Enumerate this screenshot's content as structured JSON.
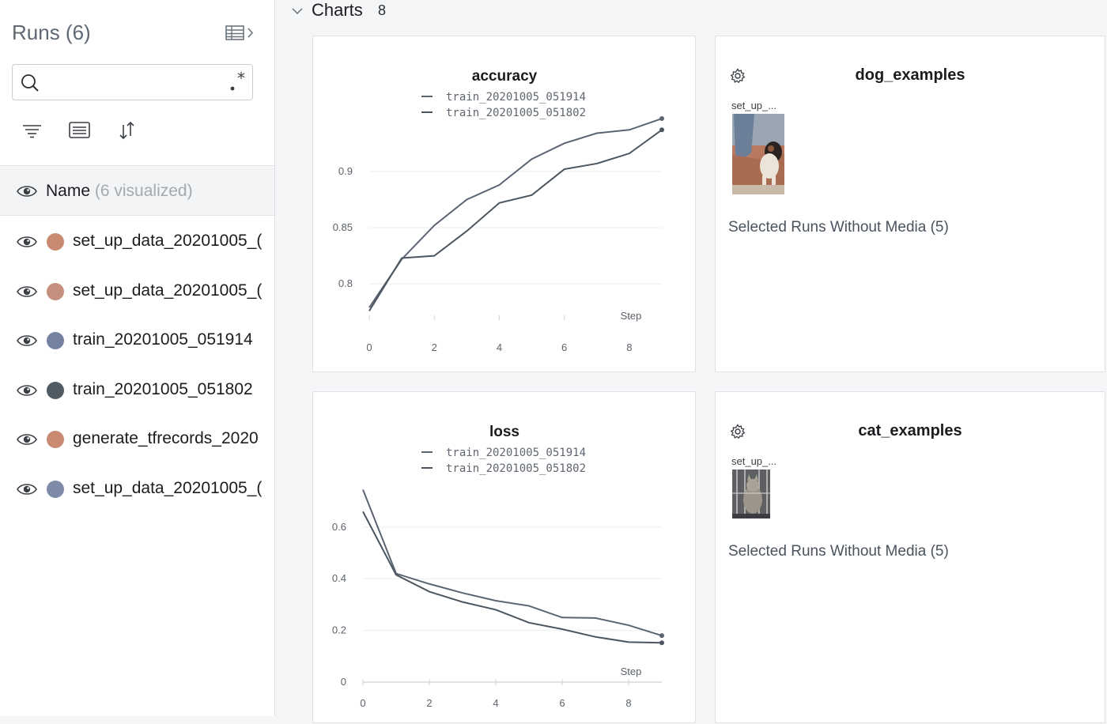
{
  "sidebar": {
    "title": "Runs (6)",
    "search": {
      "value": "",
      "placeholder": ""
    },
    "regex_label": ".*",
    "name_header": {
      "label": "Name",
      "count": "(6 visualized)"
    },
    "runs": [
      {
        "name": "set_up_data_20201005_(",
        "color": "#c98a72"
      },
      {
        "name": "set_up_data_20201005_(",
        "color": "#c4907d"
      },
      {
        "name": "train_20201005_051914",
        "color": "#7481a0"
      },
      {
        "name": "train_20201005_051802",
        "color": "#4f5a62"
      },
      {
        "name": "generate_tfrecords_2020",
        "color": "#c98a72"
      },
      {
        "name": "set_up_data_20201005_(",
        "color": "#7f8aa8"
      }
    ]
  },
  "section": {
    "title": "Charts",
    "count": "8"
  },
  "charts": [
    {
      "title": "accuracy",
      "legend": [
        "train_20201005_051914",
        "train_20201005_051802"
      ],
      "xlabel": "Step",
      "chart_data": {
        "type": "line",
        "title": "accuracy",
        "xlabel": "Step",
        "ylabel": "",
        "x": [
          0,
          1,
          2,
          3,
          4,
          5,
          6,
          7,
          8,
          9
        ],
        "xlim": [
          0,
          9
        ],
        "ylim": [
          0.765,
          0.94
        ],
        "xticks": [
          0,
          2,
          4,
          6,
          8
        ],
        "yticks": [
          0.8,
          0.85,
          0.9
        ],
        "series": [
          {
            "name": "train_20201005_051914",
            "color": "#5a6472",
            "values": [
              0.779,
              0.822,
              0.852,
              0.875,
              0.888,
              0.911,
              0.925,
              0.934,
              0.937,
              0.947
            ]
          },
          {
            "name": "train_20201005_051802",
            "color": "#4b5660",
            "values": [
              0.776,
              0.823,
              0.825,
              0.847,
              0.872,
              0.879,
              0.902,
              0.907,
              0.916,
              0.937
            ]
          }
        ]
      }
    },
    {
      "title": "loss",
      "legend": [
        "train_20201005_051914",
        "train_20201005_051802"
      ],
      "xlabel": "Step",
      "chart_data": {
        "type": "line",
        "title": "loss",
        "xlabel": "Step",
        "ylabel": "",
        "x": [
          0,
          1,
          2,
          3,
          4,
          5,
          6,
          7,
          8,
          9
        ],
        "xlim": [
          0,
          9
        ],
        "ylim": [
          0,
          0.78
        ],
        "xticks": [
          0,
          2,
          4,
          6,
          8
        ],
        "yticks": [
          0,
          0.2,
          0.4,
          0.6
        ],
        "series": [
          {
            "name": "train_20201005_051914",
            "color": "#5a6472",
            "values": [
              0.745,
              0.42,
              0.38,
              0.345,
              0.315,
              0.295,
              0.25,
              0.248,
              0.22,
              0.18
            ]
          },
          {
            "name": "train_20201005_051802",
            "color": "#4b5660",
            "values": [
              0.66,
              0.415,
              0.35,
              0.31,
              0.28,
              0.23,
              0.205,
              0.175,
              0.155,
              0.152
            ]
          }
        ]
      }
    }
  ],
  "media_panels": [
    {
      "title": "dog_examples",
      "run_label": "set_up_...",
      "no_media": "Selected Runs Without Media (5)",
      "image": "dog-photo"
    },
    {
      "title": "cat_examples",
      "run_label": "set_up_...",
      "no_media": "Selected Runs Without Media (5)",
      "image": "cat-photo"
    }
  ]
}
